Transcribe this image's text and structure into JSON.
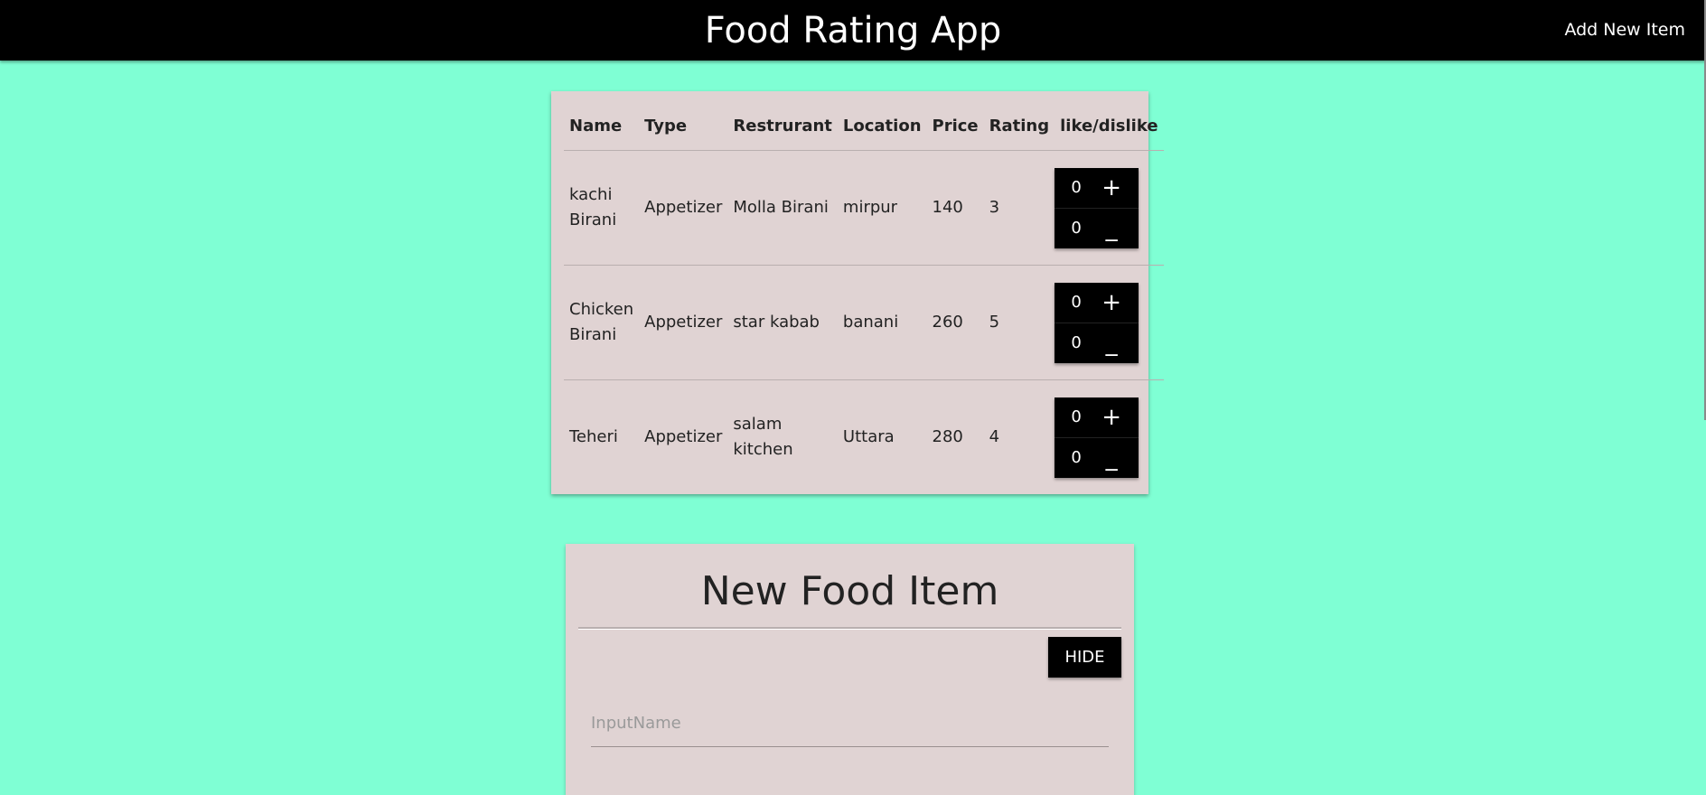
{
  "header": {
    "title": "Food Rating App",
    "add_link": "Add New Item"
  },
  "table": {
    "columns": [
      "Name",
      "Type",
      "Restrurant",
      "Location",
      "Price",
      "Rating",
      "like/dislike"
    ],
    "rows": [
      {
        "name": "kachi Birani",
        "type": "Appetizer",
        "restaurant": "Molla Birani",
        "location": "mirpur",
        "price": "140",
        "rating": "3",
        "likes": "0",
        "dislikes": "0"
      },
      {
        "name": "Chicken Birani",
        "type": "Appetizer",
        "restaurant": "star kabab",
        "location": "banani",
        "price": "260",
        "rating": "5",
        "likes": "0",
        "dislikes": "0"
      },
      {
        "name": "Teheri",
        "type": "Appetizer",
        "restaurant": "salam kitchen",
        "location": "Uttara",
        "price": "280",
        "rating": "4",
        "likes": "0",
        "dislikes": "0"
      }
    ],
    "like_symbol": "+",
    "dislike_symbol": "_"
  },
  "form": {
    "title": "New Food Item",
    "hide_label": "HIDE",
    "name_placeholder": "InputName",
    "name_value": ""
  },
  "colors": {
    "background": "#7fffd4",
    "header": "#000000",
    "card": "#e0d3d3"
  }
}
